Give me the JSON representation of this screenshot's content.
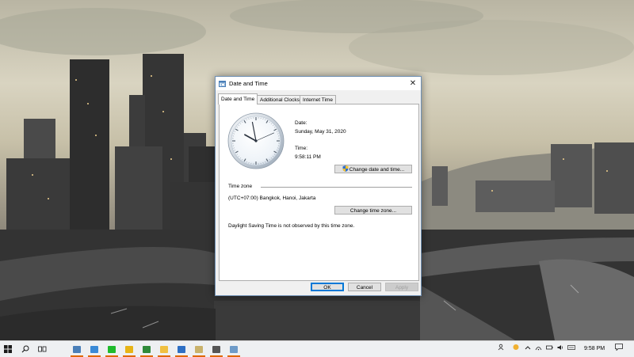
{
  "dialog": {
    "title": "Date and Time",
    "close_glyph": "✕",
    "tabs": [
      {
        "label": "Date and Time",
        "active": true
      },
      {
        "label": "Additional Clocks",
        "active": false
      },
      {
        "label": "Internet Time",
        "active": false
      }
    ],
    "date_label": "Date:",
    "date_value": "Sunday, May 31, 2020",
    "time_label": "Time:",
    "time_value": "9:58:11 PM",
    "change_datetime_button": "Change date and time...",
    "timezone_heading": "Time zone",
    "timezone_value": "(UTC+07:00) Bangkok, Hanoi, Jakarta",
    "change_timezone_button": "Change time zone...",
    "dst_note": "Daylight Saving Time is not observed by this time zone.",
    "ok_button": "OK",
    "cancel_button": "Cancel",
    "apply_button": "Apply"
  },
  "taskbar": {
    "start_icon": "windows-logo-icon",
    "search_icon": "search-icon",
    "taskview_icon": "task-view-icon",
    "apps": [
      {
        "name": "control-panel-icon",
        "color": "#4a7fb8"
      },
      {
        "name": "notepad-icon",
        "color": "#3a8ad6"
      },
      {
        "name": "line-icon",
        "color": "#1fbb2c"
      },
      {
        "name": "chrome-icon",
        "color": "#e7b416"
      },
      {
        "name": "app-green-icon",
        "color": "#2f8a3a"
      },
      {
        "name": "file-explorer-icon",
        "color": "#f0c040"
      },
      {
        "name": "app-blue-icon",
        "color": "#2d6fc4"
      },
      {
        "name": "notes-icon",
        "color": "#c9b26b"
      },
      {
        "name": "settings-icon",
        "color": "#555555"
      },
      {
        "name": "date-time-icon",
        "color": "#6e9bc8"
      }
    ],
    "clock_time": "9:58 PM",
    "tray_icons": [
      "people-icon",
      "weather-icon",
      "chevron-up-icon",
      "network-icon",
      "wifi-icon",
      "volume-icon",
      "keyboard-icon"
    ],
    "notification_icon": "notification-icon"
  }
}
